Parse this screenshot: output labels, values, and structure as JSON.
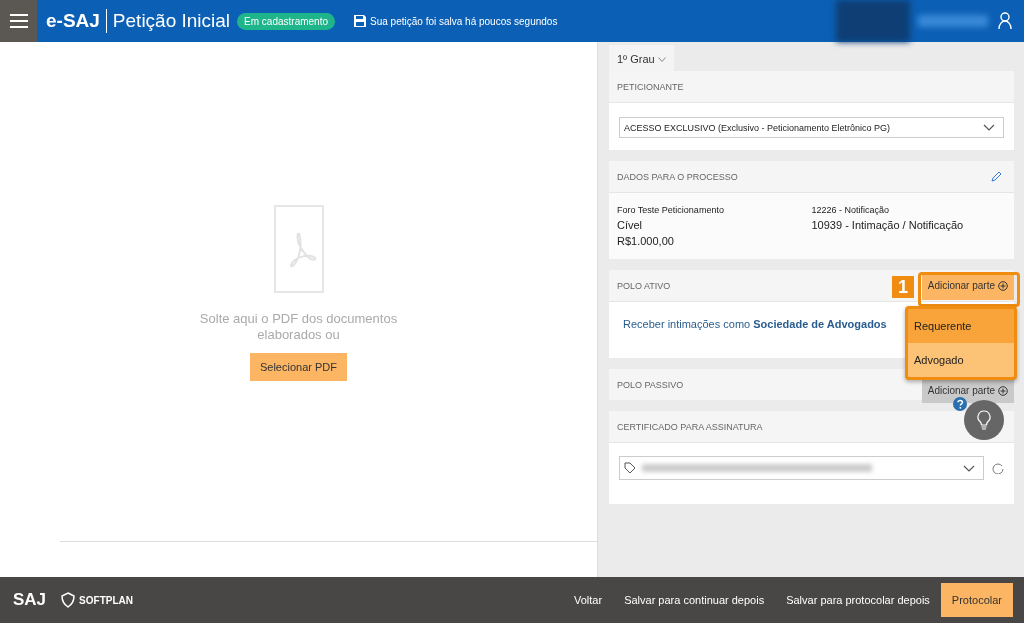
{
  "header": {
    "brand": "e-SAJ",
    "title": "Petição Inicial",
    "status_badge": "Em cadastramento",
    "save_notice": "Sua petição foi salva há poucos segundos"
  },
  "drop_zone": {
    "message": "Solte aqui o PDF dos documentos elaborados ou",
    "button": "Selecionar PDF"
  },
  "instance_selector": {
    "value": "1º Grau"
  },
  "peticionante": {
    "title": "PETICIONANTE",
    "value": "ACESSO EXCLUSIVO (Exclusivo - Peticionamento Eletrônico PG)"
  },
  "dados_processo": {
    "title": "DADOS PARA O PROCESSO",
    "column_1": [
      "Foro Teste Peticionamento",
      "Cível",
      "R$1.000,00"
    ],
    "column_2": [
      "12226 - Notificação",
      "10939 - Intimação / Notificação"
    ]
  },
  "polo_ativo": {
    "title": "POLO ATIVO",
    "add_button": "Adicionar parte",
    "link": "Receber intimações como **Sociedade de Advogados**"
  },
  "add_menu": {
    "step": "1",
    "items": [
      {
        "label": "Requerente",
        "selected": true
      },
      {
        "label": "Advogado",
        "selected": false
      }
    ]
  },
  "polo_passivo": {
    "title": "POLO PASSIVO",
    "add_button": "Adicionar parte"
  },
  "certificado": {
    "title": "CERTIFICADO PARA ASSINATURA"
  },
  "footer": {
    "logo": "SAJ",
    "company": "SOFTPLAN",
    "buttons": [
      {
        "label": "Voltar",
        "kind": "plain"
      },
      {
        "label": "Salvar para continuar depois",
        "kind": "plain"
      },
      {
        "label": "Salvar para protocolar depois",
        "kind": "plain"
      },
      {
        "label": "Protocolar",
        "kind": "primary"
      }
    ]
  }
}
